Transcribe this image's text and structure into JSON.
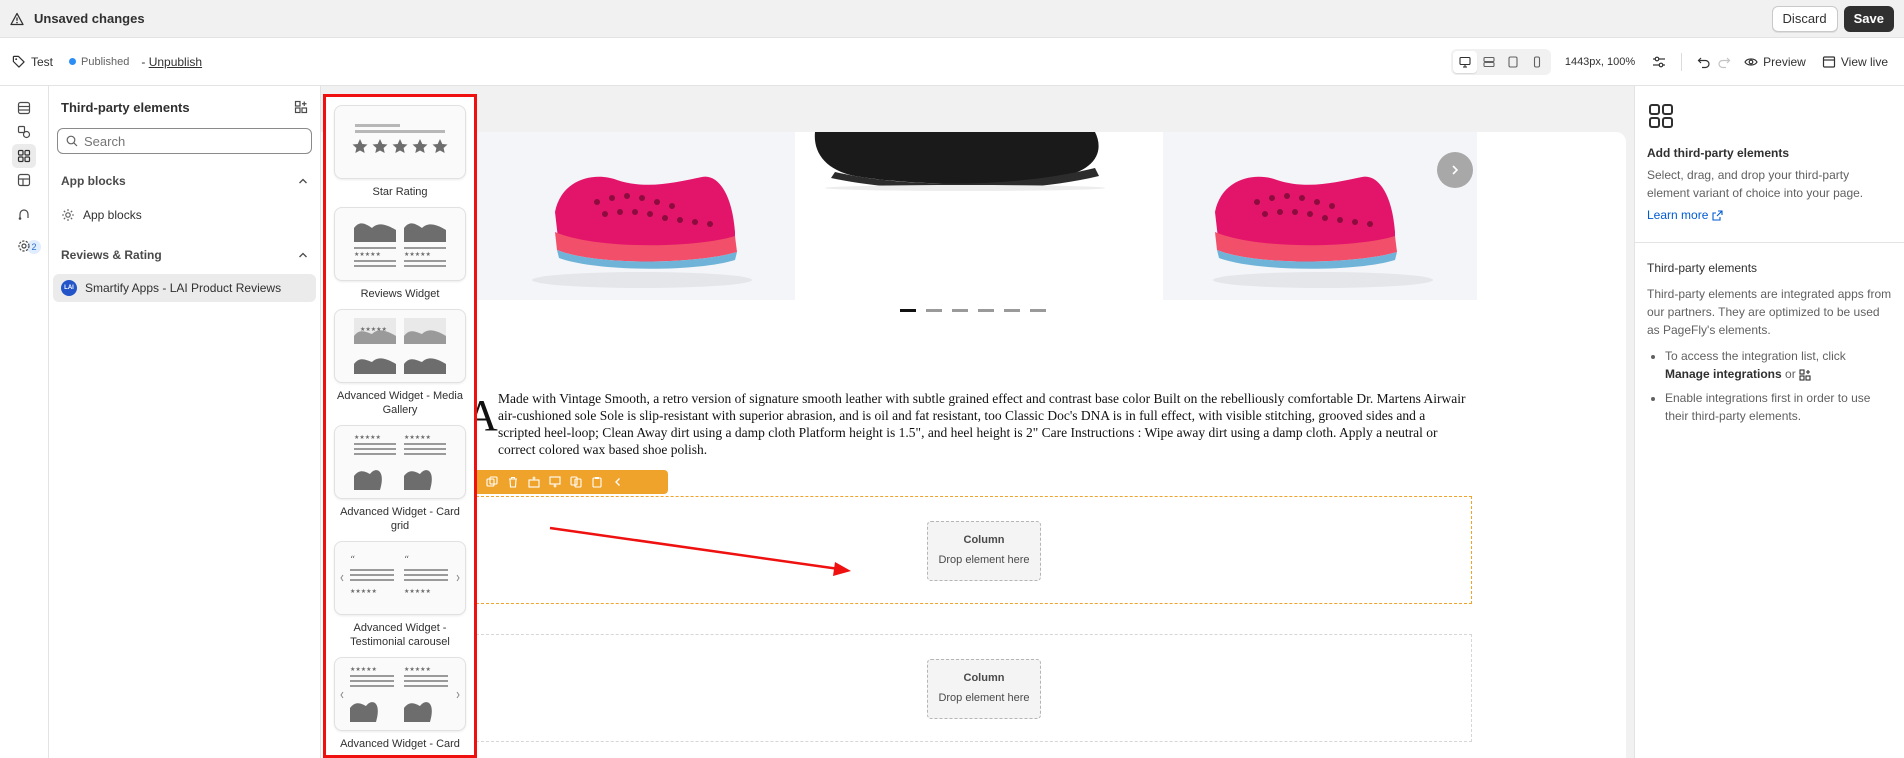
{
  "topbar": {
    "title": "Unsaved changes",
    "discard_label": "Discard",
    "save_label": "Save"
  },
  "subbar": {
    "page_name": "Test",
    "status": "Published",
    "unpublish_prefix": "-",
    "unpublish_label": "Unpublish",
    "zoom": "1443px, 100%",
    "preview_label": "Preview",
    "view_live_label": "View live"
  },
  "rail": {
    "notifications_count": "2"
  },
  "panel": {
    "title": "Third-party elements",
    "search_placeholder": "Search",
    "sections": [
      {
        "title": "App blocks",
        "items": [
          "App blocks"
        ]
      },
      {
        "title": "Reviews & Rating",
        "items": [
          "Smartify Apps - LAI Product Reviews"
        ]
      }
    ],
    "lai_logo_text": "LAI"
  },
  "widgets": [
    "Star Rating",
    "Reviews Widget",
    "Advanced Widget - Media Gallery",
    "Advanced Widget - Card grid",
    "Advanced Widget - Testimonial carousel",
    "Advanced Widget - Card"
  ],
  "canvas": {
    "drop_cap": "A",
    "description": "Made with Vintage Smooth, a retro version of signature smooth leather with subtle grained effect and contrast base color Built on the rebelliously comfortable Dr. Martens Airwair air-cushioned sole Sole is slip-resistant with superior abrasion, and is oil and fat resistant, too Classic Doc's DNA is in full effect, with visible stitching, grooved sides and a scripted heel-loop; Clean Away dirt using a damp cloth Platform height is 1.5\", and heel height is 2\" Care Instructions : Wipe away dirt using a damp cloth. Apply a neutral or correct colored wax based shoe polish.",
    "column_title": "Column",
    "column_hint": "Drop element here",
    "carousel_slide_count": 6,
    "active_slide": 1
  },
  "rpanel": {
    "title": "Add third-party elements",
    "intro": "Select, drag, and drop your third-party element variant of choice into your page.",
    "learn_more": "Learn more",
    "section_title": "Third-party elements",
    "section_text": "Third-party elements are integrated apps from our partners. They are optimized to be used as PageFly's elements.",
    "bullet1_prefix": "To access the integration list, click",
    "bullet1_bold": "Manage integrations",
    "bullet1_suffix": "or",
    "bullet2": "Enable integrations first in order to use their third-party elements."
  },
  "colors": {
    "highlight_red": "#ef1010",
    "accent_orange": "#f0a32b",
    "link_blue": "#005bd3",
    "shoe_pink": "#e3156b"
  }
}
